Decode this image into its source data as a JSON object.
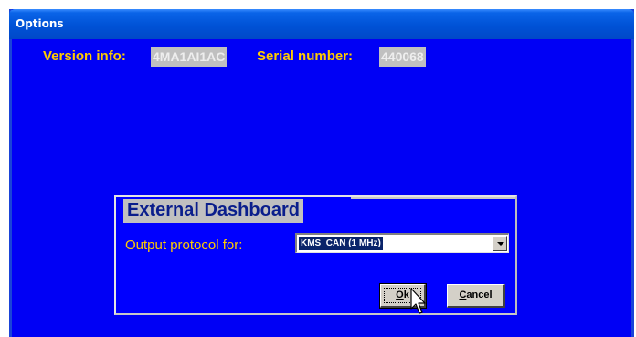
{
  "window": {
    "title": "Options"
  },
  "info": {
    "version_label": "Version info:",
    "version_value": "4MA1AI1AC",
    "serial_label": "Serial number:",
    "serial_value": "440068"
  },
  "dashboard": {
    "title": "External Dashboard",
    "protocol_label": "Output protocol for:",
    "protocol_value": "KMS_CAN (1 MHz)"
  },
  "buttons": {
    "ok_mnemonic": "O",
    "ok_rest": "k",
    "cancel_mnemonic": "C",
    "cancel_rest": "ancel"
  },
  "colors": {
    "background": "#0000f5",
    "label": "#ffcc00",
    "value_box": "#c0c0c0",
    "panel_title": "#0a1e8c"
  }
}
